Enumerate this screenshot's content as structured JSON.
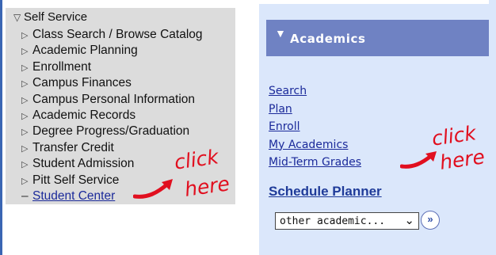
{
  "nav": {
    "root_label": "Self Service",
    "items": [
      "Class Search / Browse Catalog",
      "Academic Planning",
      "Enrollment",
      "Campus Finances",
      "Campus Personal Information",
      "Academic Records",
      "Degree Progress/Graduation",
      "Transfer Credit",
      "Student Admission",
      "Pitt Self Service"
    ],
    "student_center": "Student Center"
  },
  "academics": {
    "title": "Academics",
    "links": [
      "Search",
      "Plan",
      "Enroll",
      "My Academics",
      "Mid-Term Grades"
    ],
    "schedule_planner": "Schedule Planner",
    "select_value": "other academic...",
    "go_symbol": "»"
  },
  "annotations": {
    "left_line1": "click",
    "left_line2": "here",
    "right_line1": "click",
    "right_line2": "here"
  },
  "colors": {
    "header_bg": "#6f82c3",
    "link": "#1b2a9a",
    "annotation": "#e10f1f",
    "nav_bg": "#dcdcdc",
    "panel_bg": "#dbe7fb"
  }
}
